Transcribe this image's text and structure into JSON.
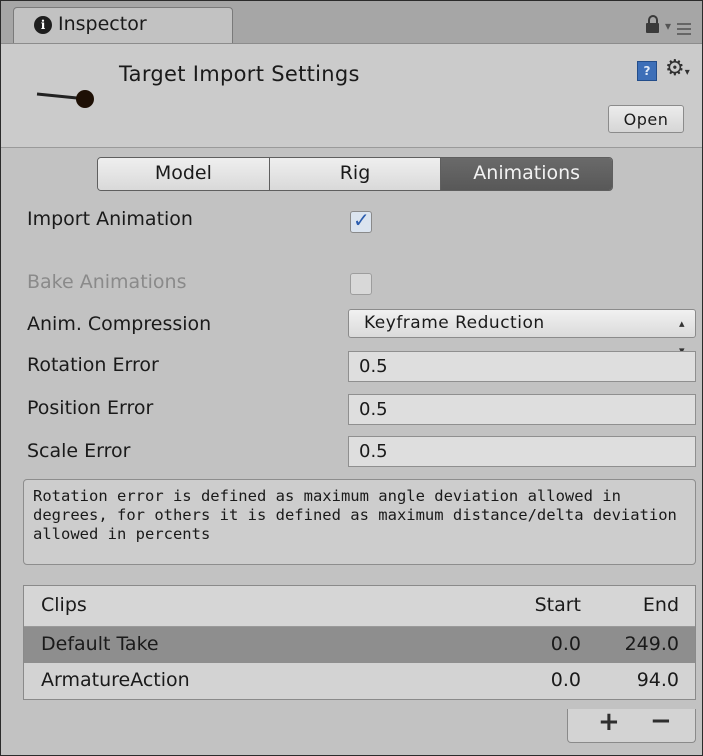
{
  "tab": {
    "label": "Inspector",
    "info_glyph": "i"
  },
  "header": {
    "title": "Target Import Settings",
    "open_label": "Open",
    "help_glyph": "?",
    "gear_glyph": "⚙"
  },
  "segments": [
    "Model",
    "Rig",
    "Animations"
  ],
  "active_segment": "Animations",
  "import_animation": {
    "label": "Import Animation",
    "checked": true
  },
  "bake_animations": {
    "label": "Bake Animations",
    "checked": false,
    "enabled": false
  },
  "anim_compression": {
    "label": "Anim. Compression",
    "value": "Keyframe Reduction"
  },
  "rotation_error": {
    "label": "Rotation Error",
    "value": "0.5"
  },
  "position_error": {
    "label": "Position Error",
    "value": "0.5"
  },
  "scale_error": {
    "label": "Scale Error",
    "value": "0.5"
  },
  "help_text": "Rotation error is defined as maximum angle deviation allowed in degrees, for others it is defined as maximum distance/delta deviation allowed in percents",
  "clips": {
    "headers": {
      "name": "Clips",
      "start": "Start",
      "end": "End"
    },
    "rows": [
      {
        "name": "Default Take",
        "start": "0.0",
        "end": "249.0",
        "selected": true
      },
      {
        "name": "ArmatureAction",
        "start": "0.0",
        "end": "94.0",
        "selected": false
      }
    ],
    "add_label": "+",
    "remove_label": "−"
  },
  "colors": {
    "panel": "#c2c2c2",
    "active_segment": "#5f5f5f",
    "selected_row": "#8e8e8e",
    "checkmark": "#2a5cae"
  }
}
